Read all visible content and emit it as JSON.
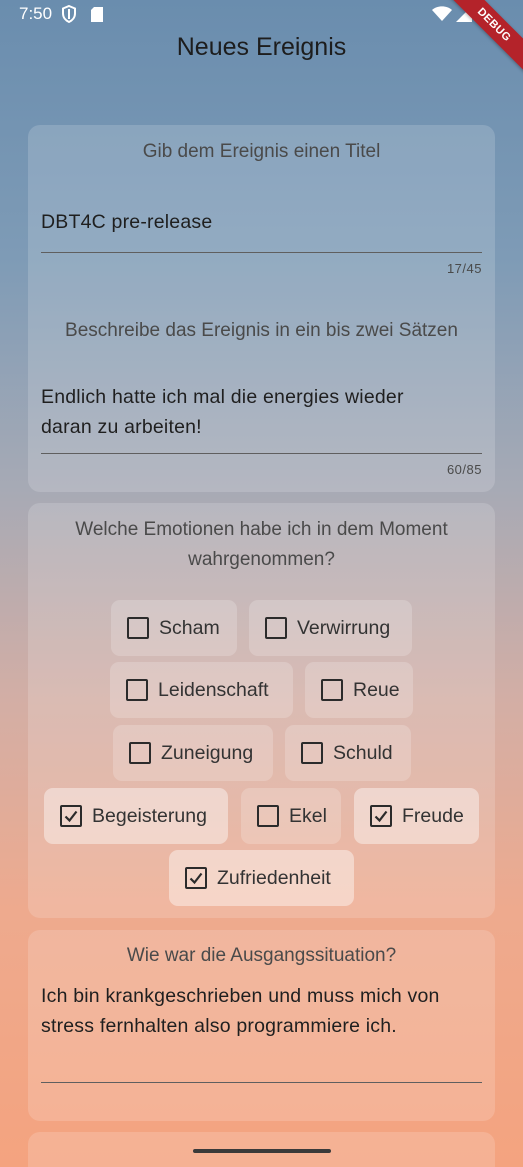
{
  "status_bar": {
    "time": "7:50"
  },
  "debug_banner": "DEBUG",
  "app_bar": {
    "title": "Neues Ereignis"
  },
  "event_card": {
    "title_prompt": "Gib dem Ereignis einen Titel",
    "title_value": "DBT4C pre-release",
    "title_counter": "17/45",
    "description_prompt": "Beschreibe das Ereignis in ein bis zwei Sätzen",
    "description_value_line1": "Endlich hatte ich mal die energies wieder",
    "description_value_line2": "daran zu arbeiten!",
    "description_counter": "60/85"
  },
  "emotions_card": {
    "prompt_line1": "Welche Emotionen habe ich in dem Moment",
    "prompt_line2": "wahrgenommen?",
    "options": [
      {
        "label": "Scham",
        "checked": false
      },
      {
        "label": "Verwirrung",
        "checked": false
      },
      {
        "label": "Leidenschaft",
        "checked": false
      },
      {
        "label": "Reue",
        "checked": false
      },
      {
        "label": "Zuneigung",
        "checked": false
      },
      {
        "label": "Schuld",
        "checked": false
      },
      {
        "label": "Begeisterung",
        "checked": true
      },
      {
        "label": "Ekel",
        "checked": false
      },
      {
        "label": "Freude",
        "checked": true
      },
      {
        "label": "Zufriedenheit",
        "checked": true
      }
    ]
  },
  "situation_card": {
    "prompt": "Wie war die Ausgangssituation?",
    "value_line1": "Ich bin krankgeschrieben und muss mich von",
    "value_line2": "stress fernhalten also programmiere ich."
  }
}
